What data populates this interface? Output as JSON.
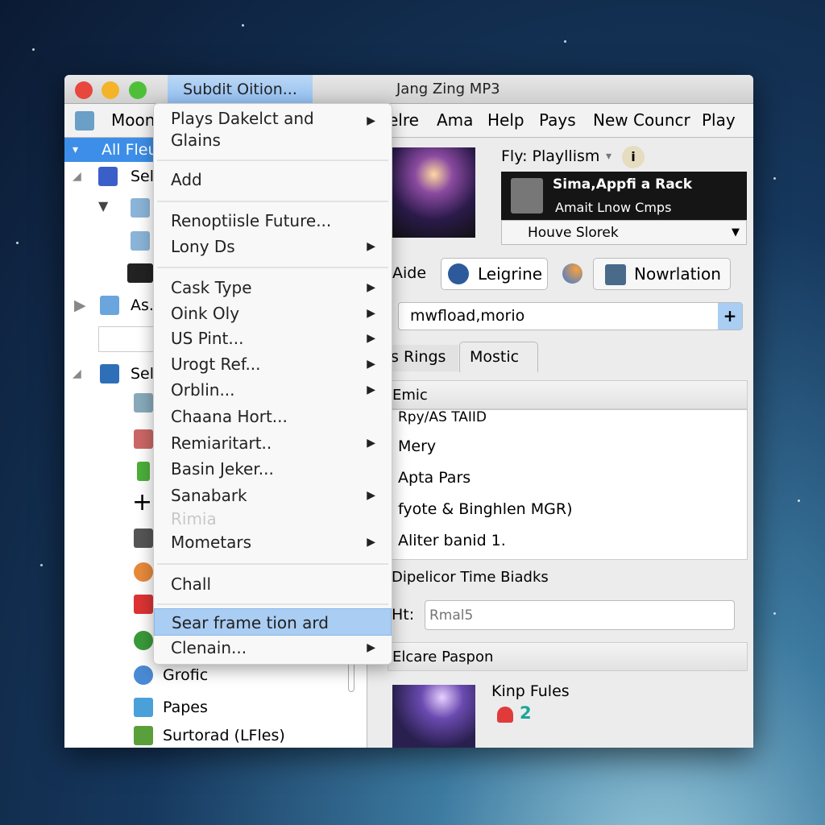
{
  "window": {
    "menu_title": "Subdit Oition...",
    "title": "Jang Zing MP3"
  },
  "toolbar": {
    "items": [
      "Moon",
      "elre",
      "Ama",
      "Help",
      "Pays",
      "New Councr",
      "Play"
    ]
  },
  "sidebar": {
    "selected": "All Fleu",
    "rows": [
      "Sel",
      "As.",
      "Sel"
    ],
    "bottom_items": [
      "Grofic",
      "Papes",
      "Surtorad (LFles)"
    ]
  },
  "menu": {
    "items": [
      {
        "label": "Plays Dakelct and",
        "label2": "Glains",
        "submenu": true
      },
      {
        "label": "Add",
        "submenu": false
      },
      {
        "label": "Renoptiisle Future...",
        "submenu": false
      },
      {
        "label": "Lony Ds",
        "submenu": true
      },
      {
        "label": "Cask Type",
        "submenu": true
      },
      {
        "label": "Oink Oly",
        "submenu": true
      },
      {
        "label": "US Pint...",
        "submenu": true
      },
      {
        "label": "Urogt Ref...",
        "submenu": true
      },
      {
        "label": "Orblin...",
        "submenu": true
      },
      {
        "label": "Chaana Hort...",
        "submenu": false
      },
      {
        "label": "Remiaritart..",
        "submenu": true
      },
      {
        "label": "Basin Jeker...",
        "submenu": false
      },
      {
        "label": "Sanabark",
        "submenu": true
      },
      {
        "label": "Rimia",
        "disabled": true
      },
      {
        "label": "Mometars",
        "submenu": true
      },
      {
        "label": "Chall",
        "submenu": false
      },
      {
        "label": "Sear frame tion ard",
        "highlighted": true
      },
      {
        "label": "Clenain...",
        "submenu": true
      }
    ]
  },
  "player": {
    "playlist_label": "Fly: Playllism",
    "now_title": "Sima,Appfi a Rack",
    "now_sub": "Amait Lnow Cmps",
    "source": "Houve Slorek",
    "aide": "Aide",
    "button1": "Leigrine",
    "button2": "Nowrlation",
    "search_value": "mwfload,morio",
    "tabs": [
      "s Rings",
      "Mostic"
    ],
    "active_tab": "Mostic"
  },
  "list": {
    "header": "Emic",
    "items": [
      "Rpy/AS TAIID",
      "Mery",
      "Apta Pars",
      "fyote & Binghlen MGR)",
      "Aliter banid 1."
    ]
  },
  "section2": {
    "header": "Dipelicor Time Biadks",
    "field_label": "Ht:",
    "field_placeholder": "Rmal5"
  },
  "section3": {
    "header": "Elcare Paspon",
    "item_title": "Kinp Fules",
    "count": "2"
  },
  "colors": {
    "selection": "#3d8ee8",
    "highlight": "#a9cdf3"
  }
}
